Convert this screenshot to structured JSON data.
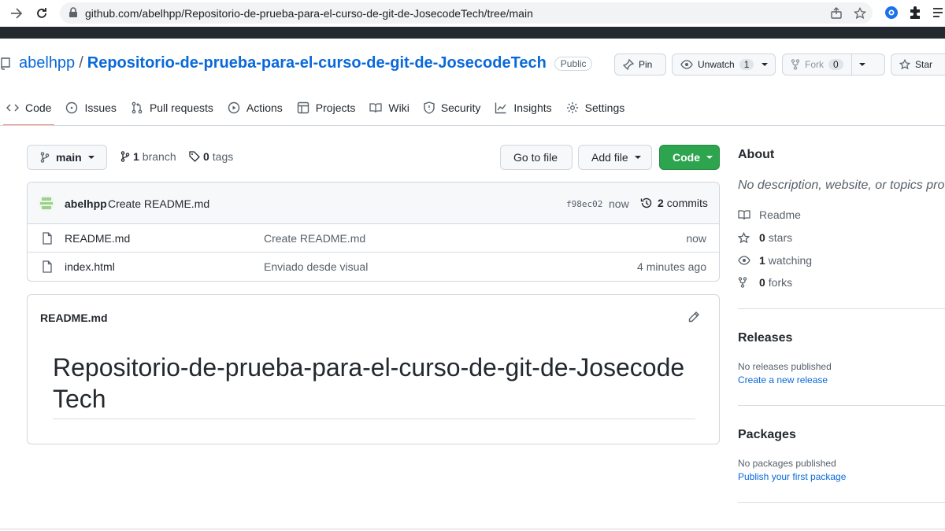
{
  "browser": {
    "url": "github.com/abelhpp/Repositorio-de-prueba-para-el-curso-de-git-de-JosecodeTech/tree/main"
  },
  "repo": {
    "owner": "abelhpp",
    "separator": "/",
    "name": "Repositorio-de-prueba-para-el-curso-de-git-de-JosecodeTech",
    "visibility": "Public",
    "actions": {
      "pin_label": "Pin",
      "unwatch_label": "Unwatch",
      "unwatch_count": "1",
      "fork_label": "Fork",
      "fork_count": "0",
      "star_label": "Star"
    }
  },
  "tabs": [
    {
      "label": "Code",
      "icon": "code-icon",
      "active": true
    },
    {
      "label": "Issues",
      "icon": "issue-icon"
    },
    {
      "label": "Pull requests",
      "icon": "pull-request-icon"
    },
    {
      "label": "Actions",
      "icon": "play-icon"
    },
    {
      "label": "Projects",
      "icon": "table-icon"
    },
    {
      "label": "Wiki",
      "icon": "book-icon"
    },
    {
      "label": "Security",
      "icon": "shield-icon"
    },
    {
      "label": "Insights",
      "icon": "graph-icon"
    },
    {
      "label": "Settings",
      "icon": "gear-icon"
    }
  ],
  "toolbar": {
    "branch_label": "main",
    "branch_count": "1",
    "branch_word": "branch",
    "tag_count": "0",
    "tag_word": "tags",
    "goto_file": "Go to file",
    "add_file": "Add file",
    "code": "Code"
  },
  "commit": {
    "author": "abelhpp",
    "message": "Create README.md",
    "sha": "f98ec02",
    "when": "now",
    "commit_count": "2",
    "commit_word": "commits"
  },
  "files": [
    {
      "name": "README.md",
      "message": "Create README.md",
      "age": "now"
    },
    {
      "name": "index.html",
      "message": "Enviado desde visual",
      "age": "4 minutes ago"
    }
  ],
  "readme": {
    "filename": "README.md",
    "heading": "Repositorio-de-prueba-para-el-curso-de-git-de-JosecodeTech"
  },
  "sidebar": {
    "about_title": "About",
    "about_desc": "No description, website, or topics provi",
    "stats": [
      {
        "count": "",
        "label": "Readme",
        "icon": "book-icon"
      },
      {
        "count": "0",
        "label": "stars",
        "icon": "star-icon"
      },
      {
        "count": "1",
        "label": "watching",
        "icon": "eye-icon"
      },
      {
        "count": "0",
        "label": "forks",
        "icon": "fork-icon"
      }
    ],
    "releases_title": "Releases",
    "releases_none": "No releases published",
    "releases_link": "Create a new release",
    "packages_title": "Packages",
    "packages_none": "No packages published",
    "packages_link": "Publish your first package"
  },
  "colors": {
    "link": "#0969da",
    "primary_button": "#2da44e",
    "active_tab_underline": "#fd8c73",
    "header_strip": "#24292f"
  }
}
